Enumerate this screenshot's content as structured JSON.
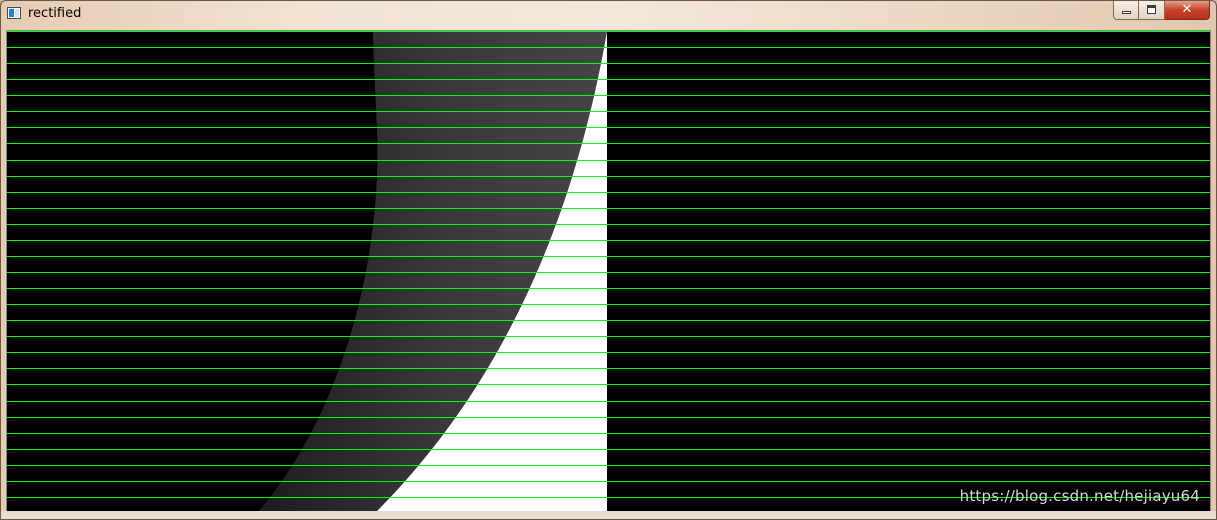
{
  "window": {
    "title": "rectified",
    "controls": {
      "minimize_icon": "minimize-icon",
      "maximize_icon": "maximize-icon",
      "close_icon": "close-icon",
      "close_glyph": "✕"
    }
  },
  "image_view": {
    "left_panel": "rectified-left-image",
    "right_panel": "rectified-right-image",
    "epipolar_line_count": 30,
    "colors": {
      "epipolar_line": "#00ff00",
      "background": "#000000",
      "lens_edge": "#3a3a3a",
      "bright_region": "#ffffff"
    }
  },
  "watermark": {
    "text": "https://blog.csdn.net/hejiayu64"
  }
}
